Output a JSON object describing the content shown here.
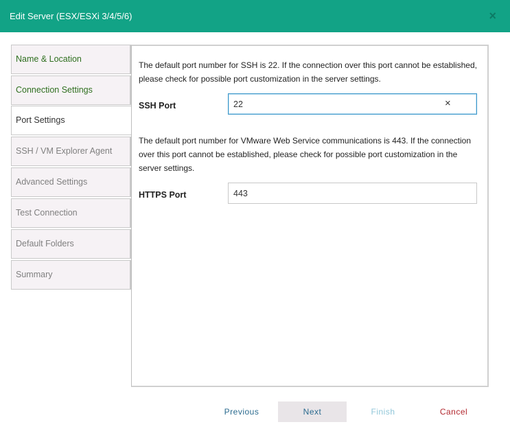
{
  "window": {
    "title": "Edit Server (ESX/ESXi 3/4/5/6)",
    "close_glyph": "×"
  },
  "nav": {
    "items": [
      {
        "label": "Name & Location",
        "state": "done"
      },
      {
        "label": "Connection Settings",
        "state": "done"
      },
      {
        "label": "Port Settings",
        "state": "active"
      },
      {
        "label": "SSH / VM Explorer Agent",
        "state": "pending"
      },
      {
        "label": "Advanced Settings",
        "state": "pending"
      },
      {
        "label": "Test Connection",
        "state": "pending"
      },
      {
        "label": "Default Folders",
        "state": "pending"
      },
      {
        "label": "Summary",
        "state": "pending"
      }
    ]
  },
  "ssh": {
    "description": "The default port number for SSH is 22. If the connection over this port cannot be established, please check for possible port customization in the server settings.",
    "label": "SSH Port",
    "value": "22",
    "clear_glyph": "×"
  },
  "https": {
    "description": "The default port number for VMware Web Service communications is 443. If the connection over this port cannot be established, please check for possible port customization in the server settings.",
    "label": "HTTPS Port",
    "value": "443"
  },
  "footer": {
    "previous": "Previous",
    "next": "Next",
    "finish": "Finish",
    "cancel": "Cancel"
  },
  "colors": {
    "titlebar": "#12a386",
    "nav_done": "#2f6f1f",
    "nav_pending": "#808080",
    "link_blue": "#2b6b8f",
    "cancel_red": "#b2282f",
    "focus_border": "#3b96c9"
  }
}
